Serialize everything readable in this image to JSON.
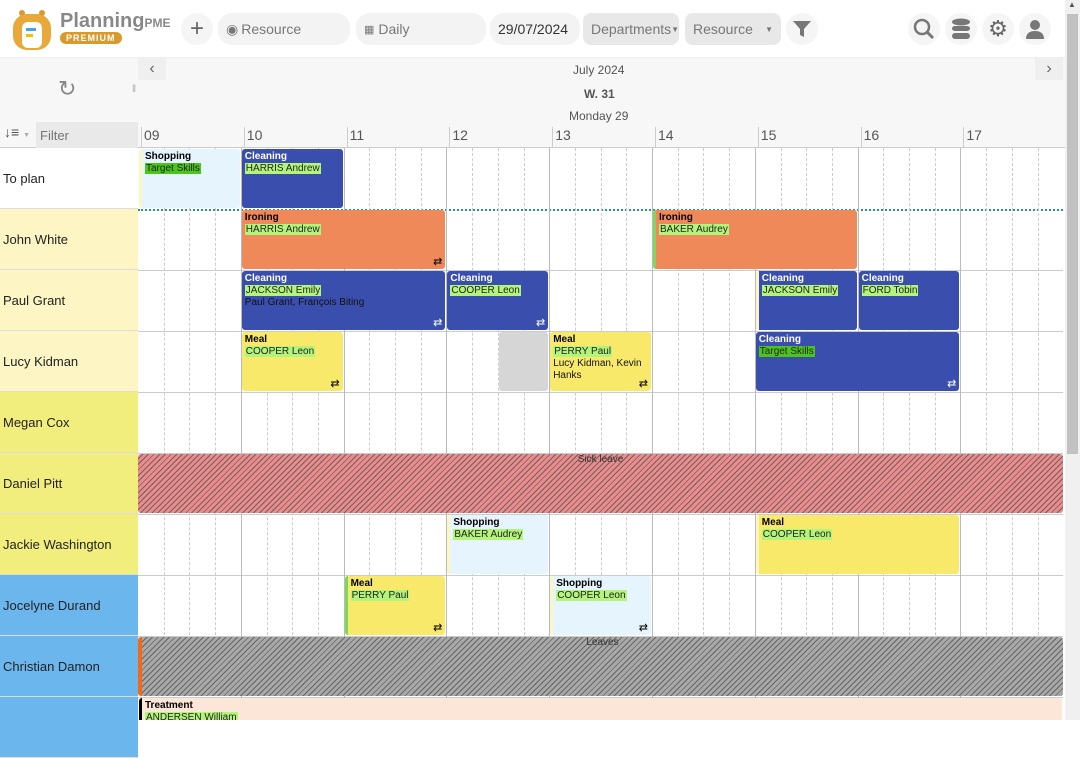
{
  "app": {
    "brand": "Planning",
    "brand_suffix": "PME",
    "badge": "PREMIUM"
  },
  "toolbar": {
    "add": "+",
    "resource_view": "Resource",
    "period": "Daily",
    "date": "29/07/2024",
    "departments": "Departments",
    "resource_filter": "Resource"
  },
  "header": {
    "month": "July 2024",
    "week": "W. 31",
    "day": "Monday 29",
    "filter_placeholder": "Filter",
    "hours": [
      "09",
      "10",
      "11",
      "12",
      "13",
      "14",
      "15",
      "16",
      "17"
    ]
  },
  "colors": {
    "blue": "#3a4fad",
    "orange": "#f0895a",
    "yellow": "#f9e96a",
    "lightblue": "#e6f4fd",
    "tag": "#b3f57a"
  },
  "rows": [
    {
      "name": "To plan",
      "bg": "#ffffff"
    },
    {
      "name": "John White",
      "bg": "#fdf5c4"
    },
    {
      "name": "Paul Grant",
      "bg": "#fdf5c4"
    },
    {
      "name": "Lucy Kidman",
      "bg": "#fdf5c4"
    },
    {
      "name": "Megan Cox",
      "bg": "#f2ee7e"
    },
    {
      "name": "Daniel Pitt",
      "bg": "#f2ee7e"
    },
    {
      "name": "Jackie Washington",
      "bg": "#f2ee7e"
    },
    {
      "name": "Jocelyne Durand",
      "bg": "#6cb6ee"
    },
    {
      "name": "Christian Damon",
      "bg": "#6cb6ee"
    },
    {
      "name": "",
      "bg": "#6cb6ee"
    }
  ],
  "events": [
    {
      "row": 0,
      "start": 9,
      "end": 10,
      "title": "Shopping",
      "res": "Target Skills",
      "dark": true,
      "color": "#e6f4fd",
      "edge": "#fdf5c4",
      "text": "#000"
    },
    {
      "row": 0,
      "start": 10,
      "end": 11,
      "title": "Cleaning",
      "res": "HARRIS Andrew",
      "color": "#3a4fad",
      "text": "#fff"
    },
    {
      "row": 1,
      "start": 10,
      "end": 12,
      "title": "Ironing",
      "res": "HARRIS Andrew",
      "color": "#f0895a",
      "text": "#000",
      "repeat": true
    },
    {
      "row": 1,
      "start": 14,
      "end": 16,
      "title": "Ironing",
      "res": "BAKER Audrey",
      "color": "#f0895a",
      "edge": "#7fd65a",
      "text": "#000"
    },
    {
      "row": 2,
      "start": 10,
      "end": 12,
      "title": "Cleaning",
      "res": "JACKSON Emily",
      "extra": "Paul Grant, François Biting",
      "color": "#3a4fad",
      "text": "#fff",
      "repeat": true
    },
    {
      "row": 2,
      "start": 12,
      "end": 13,
      "title": "Cleaning",
      "res": "COOPER Leon",
      "color": "#3a4fad",
      "text": "#fff",
      "repeat": true
    },
    {
      "row": 2,
      "start": 15,
      "end": 16,
      "title": "Cleaning",
      "res": "JACKSON Emily",
      "color": "#3a4fad",
      "edge": "#fdf5c4",
      "text": "#fff"
    },
    {
      "row": 2,
      "start": 16,
      "end": 17,
      "title": "Cleaning",
      "res": "FORD Tobin",
      "color": "#3a4fad",
      "text": "#fff"
    },
    {
      "row": 3,
      "start": 10,
      "end": 11,
      "title": "Meal",
      "res": "COOPER Leon",
      "color": "#f9e96a",
      "text": "#000",
      "repeat": true
    },
    {
      "row": 3,
      "start": 12.5,
      "end": 13,
      "title": "",
      "res": "",
      "color": "#d6d6d6",
      "text": "#000"
    },
    {
      "row": 3,
      "start": 13,
      "end": 14,
      "title": "Meal",
      "res": "PERRY Paul",
      "extra": "Lucy Kidman, Kevin Hanks",
      "color": "#f9e96a",
      "text": "#000",
      "repeat": true
    },
    {
      "row": 3,
      "start": 15,
      "end": 17,
      "title": "Cleaning",
      "res": "Target Skills",
      "dark": true,
      "color": "#3a4fad",
      "text": "#fff",
      "repeat": true
    },
    {
      "row": 6,
      "start": 12,
      "end": 13,
      "title": "Shopping",
      "res": "BAKER Audrey",
      "color": "#e6f4fd",
      "edge": "#fdf5c4",
      "text": "#000"
    },
    {
      "row": 6,
      "start": 15,
      "end": 17,
      "title": "Meal",
      "res": "COOPER Leon",
      "color": "#f9e96a",
      "edge": "#fdf5c4",
      "text": "#000"
    },
    {
      "row": 7,
      "start": 11,
      "end": 12,
      "title": "Meal",
      "res": "PERRY Paul",
      "color": "#f9e96a",
      "edge": "#7fd65a",
      "text": "#000",
      "repeat": true
    },
    {
      "row": 7,
      "start": 13,
      "end": 14,
      "title": "Shopping",
      "res": "COOPER Leon",
      "color": "#e6f4fd",
      "edge": "#fdf5c4",
      "text": "#000",
      "repeat": true
    },
    {
      "row": 9,
      "start": 9,
      "end": 18,
      "title": "Treatment",
      "res": "ANDERSEN William",
      "color": "#fbe6d8",
      "edge": "#000",
      "text": "#000"
    }
  ],
  "absences": [
    {
      "row": 5,
      "label": "Sick leave",
      "color": "#f08a8a"
    },
    {
      "row": 8,
      "label": "Leaves",
      "color": "#a8a8a8",
      "edge": "#f06a1a"
    }
  ]
}
